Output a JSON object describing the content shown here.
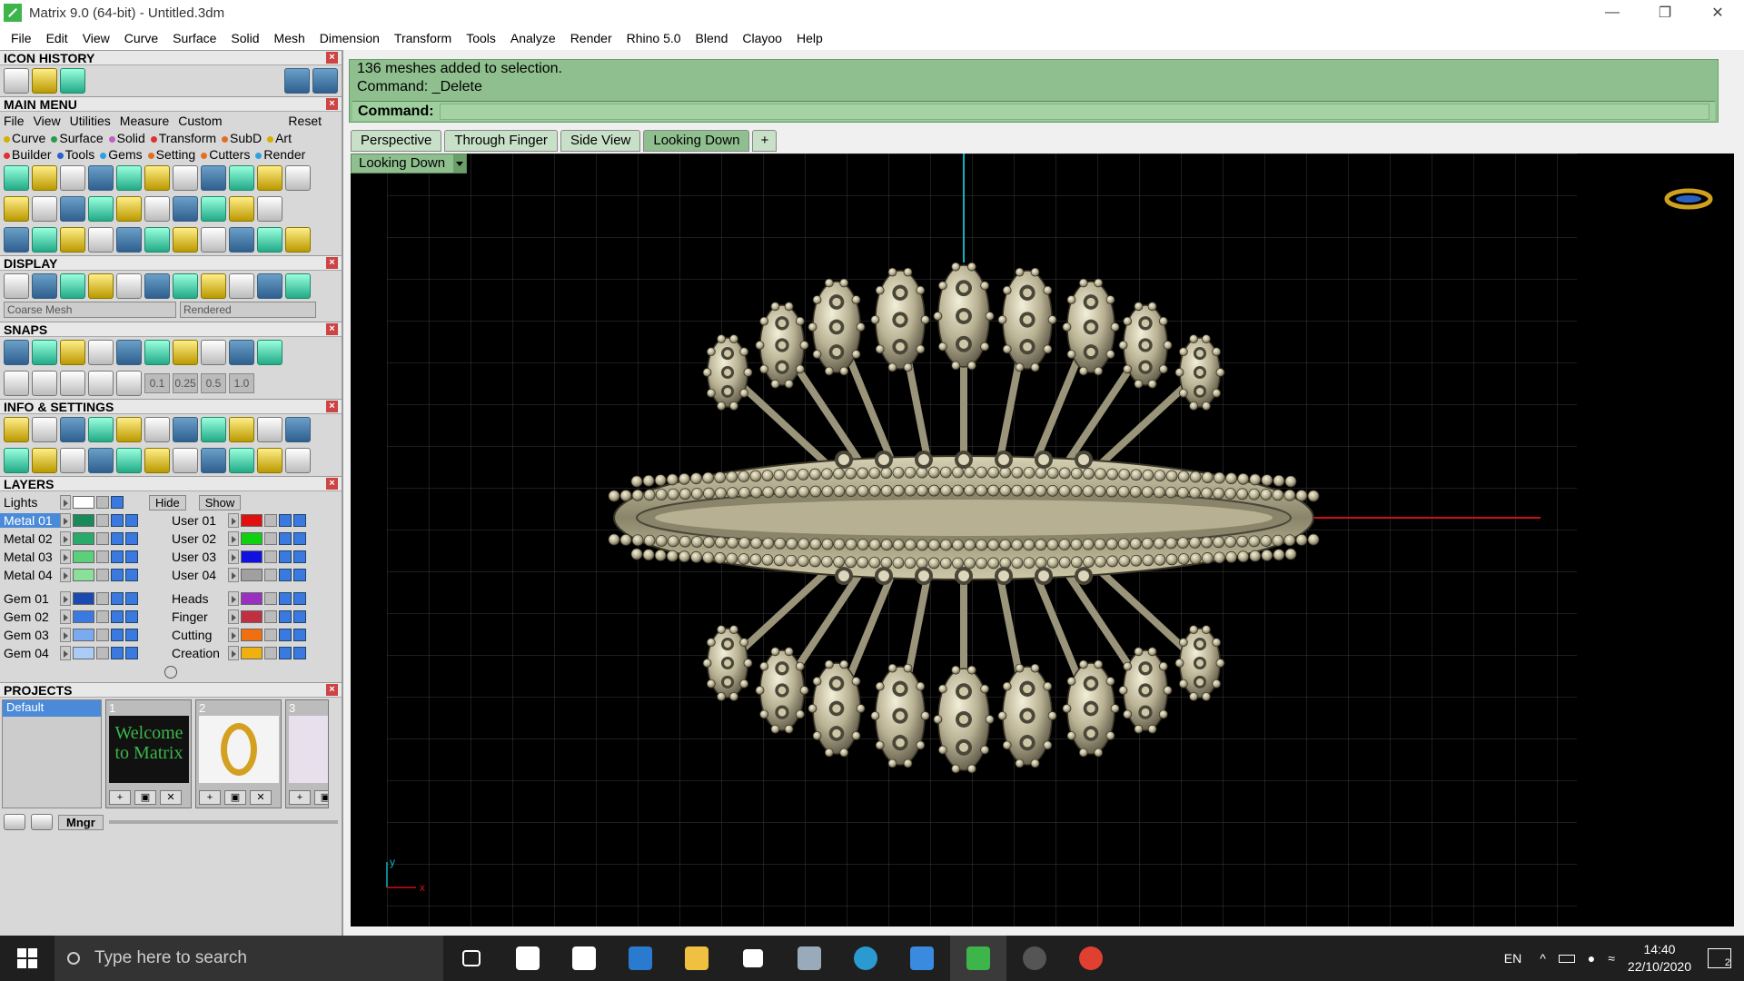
{
  "window": {
    "title": "Matrix 9.0 (64-bit) - Untitled.3dm"
  },
  "menubar": [
    "File",
    "Edit",
    "View",
    "Curve",
    "Surface",
    "Solid",
    "Mesh",
    "Dimension",
    "Transform",
    "Tools",
    "Analyze",
    "Render",
    "Rhino 5.0",
    "Blend",
    "Clayoo",
    "Help"
  ],
  "left": {
    "icon_history": "ICON HISTORY",
    "main_menu": "MAIN MENU",
    "main_menu_items": [
      "File",
      "View",
      "Utilities",
      "Measure",
      "Custom"
    ],
    "reset": "Reset",
    "categories_row1": [
      {
        "label": "Curve",
        "color": "#d4b000"
      },
      {
        "label": "Surface",
        "color": "#2a9a4a"
      },
      {
        "label": "Solid",
        "color": "#c060c0"
      },
      {
        "label": "Transform",
        "color": "#e03030"
      },
      {
        "label": "SubD",
        "color": "#e07020"
      },
      {
        "label": "Art",
        "color": "#d4b000"
      }
    ],
    "categories_row2": [
      {
        "label": "Builder",
        "color": "#e03030"
      },
      {
        "label": "Tools",
        "color": "#2a60d0"
      },
      {
        "label": "Gems",
        "color": "#30a0e0"
      },
      {
        "label": "Setting",
        "color": "#e07020"
      },
      {
        "label": "Cutters",
        "color": "#e07020"
      },
      {
        "label": "Render",
        "color": "#30a0e0"
      }
    ],
    "display": "DISPLAY",
    "display_mesh": "Coarse Mesh",
    "display_mode": "Rendered",
    "snaps": "SNAPS",
    "snap_values": [
      "0.1",
      "0.25",
      "0.5",
      "1.0"
    ],
    "info_settings": "INFO & SETTINGS",
    "layers": "LAYERS",
    "lights": "Lights",
    "hide": "Hide",
    "show": "Show",
    "layers_left": [
      {
        "name": "Metal 01",
        "color": "#1a8a5a",
        "selected": true
      },
      {
        "name": "Metal 02",
        "color": "#2aaa6a",
        "selected": false
      },
      {
        "name": "Metal 03",
        "color": "#5ad07a",
        "selected": false
      },
      {
        "name": "Metal 04",
        "color": "#8ae09a",
        "selected": false
      },
      {
        "name": "Gem 01",
        "color": "#1a4ab0",
        "selected": false
      },
      {
        "name": "Gem 02",
        "color": "#3a7ae0",
        "selected": false
      },
      {
        "name": "Gem 03",
        "color": "#7aaaf0",
        "selected": false
      },
      {
        "name": "Gem 04",
        "color": "#aaccf8",
        "selected": false
      }
    ],
    "layers_right": [
      {
        "name": "User 01",
        "color": "#e01010"
      },
      {
        "name": "User 02",
        "color": "#10d010"
      },
      {
        "name": "User 03",
        "color": "#1010e0"
      },
      {
        "name": "User 04",
        "color": "#a0a0a0"
      },
      {
        "name": "Heads",
        "color": "#9a30c0"
      },
      {
        "name": "Finger",
        "color": "#c03040"
      },
      {
        "name": "Cutting",
        "color": "#f07010"
      },
      {
        "name": "Creation",
        "color": "#f0b010"
      }
    ],
    "projects": "PROJECTS",
    "project_default": "Default",
    "project_thumbs": [
      {
        "num": "1",
        "caption": "Welcome to Matrix"
      },
      {
        "num": "2",
        "caption": ""
      },
      {
        "num": "3",
        "caption": ""
      }
    ],
    "mngr": "Mngr"
  },
  "command": {
    "line1": "136 meshes added to selection.",
    "line2": "Command: _Delete",
    "prompt": "Command:"
  },
  "tabs": [
    {
      "label": "Perspective",
      "active": false
    },
    {
      "label": "Through Finger",
      "active": false
    },
    {
      "label": "Side View",
      "active": false
    },
    {
      "label": "Looking Down",
      "active": true
    }
  ],
  "viewport": {
    "view_label": "Looking Down",
    "axis_y": "y",
    "axis_x": "x"
  },
  "taskbar": {
    "search_placeholder": "Type here to search",
    "lang": "EN",
    "time": "14:40",
    "date": "22/10/2020",
    "notifications": "2"
  }
}
